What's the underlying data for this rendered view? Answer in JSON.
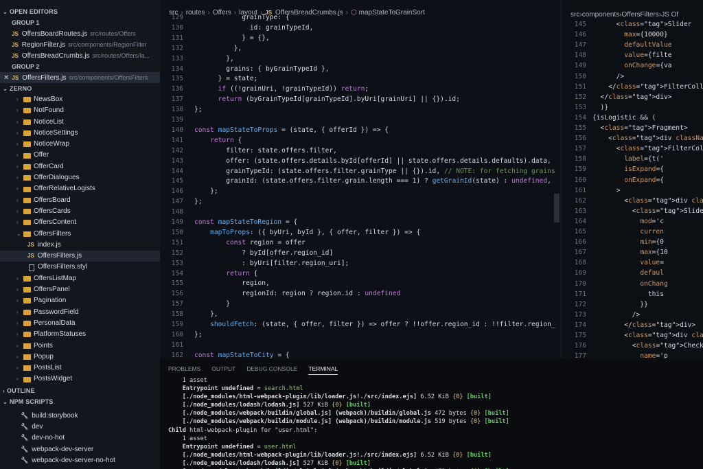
{
  "sidebar": {
    "open_editors": "OPEN EDITORS",
    "group1": "GROUP 1",
    "group2": "GROUP 2",
    "open_files_g1": [
      {
        "name": "OffersBoardRoutes.js",
        "path": "src/routes/Offers"
      },
      {
        "name": "RegionFilter.js",
        "path": "src/components/RegionFilter"
      },
      {
        "name": "OffersBreadCrumbs.js",
        "path": "src/routes/Offers/la..."
      }
    ],
    "open_files_g2": [
      {
        "name": "OffersFilters.js",
        "path": "src/components/OffersFilters"
      }
    ],
    "js_badge": "JS",
    "project": "ZERNO",
    "tree": [
      {
        "name": "NewsBox",
        "type": "folder"
      },
      {
        "name": "NotFound",
        "type": "folder"
      },
      {
        "name": "NoticeList",
        "type": "folder"
      },
      {
        "name": "NoticeSettings",
        "type": "folder"
      },
      {
        "name": "NoticeWrap",
        "type": "folder"
      },
      {
        "name": "Offer",
        "type": "folder"
      },
      {
        "name": "OfferCard",
        "type": "folder"
      },
      {
        "name": "OfferDialogues",
        "type": "folder"
      },
      {
        "name": "OfferRelativeLogists",
        "type": "folder"
      },
      {
        "name": "OffersBoard",
        "type": "folder"
      },
      {
        "name": "OffersCards",
        "type": "folder"
      },
      {
        "name": "OffersContent",
        "type": "folder"
      },
      {
        "name": "OffersFilters",
        "type": "open"
      },
      {
        "name": "index.js",
        "type": "js"
      },
      {
        "name": "OffersFilters.js",
        "type": "js",
        "selected": true
      },
      {
        "name": "OffersFilters.styl",
        "type": "file"
      },
      {
        "name": "OffersListMap",
        "type": "folder"
      },
      {
        "name": "OffersPanel",
        "type": "folder"
      },
      {
        "name": "Pagination",
        "type": "folder"
      },
      {
        "name": "PasswordField",
        "type": "folder"
      },
      {
        "name": "PersonalData",
        "type": "folder"
      },
      {
        "name": "PlatformStatuses",
        "type": "folder"
      },
      {
        "name": "Points",
        "type": "folder"
      },
      {
        "name": "Popup",
        "type": "folder"
      },
      {
        "name": "PostsList",
        "type": "folder"
      },
      {
        "name": "PostsWidget",
        "type": "folder"
      }
    ],
    "outline": "OUTLINE",
    "npm_scripts": "NPM SCRIPTS",
    "scripts": [
      "build:storybook",
      "dev",
      "dev-no-hot",
      "webpack-dev-server",
      "webpack-dev-server-no-hot"
    ]
  },
  "editor": {
    "breadcrumb": [
      "src",
      "routes",
      "Offers",
      "layout",
      "OffersBreadCrumbs.js",
      "mapStateToGrainSort"
    ],
    "lines": [
      {
        "n": "129",
        "t": "            grainType: {"
      },
      {
        "n": "130",
        "t": "              id: grainTypeId,"
      },
      {
        "n": "131",
        "t": "            } = {},"
      },
      {
        "n": "132",
        "t": "          },"
      },
      {
        "n": "133",
        "t": "        },"
      },
      {
        "n": "134",
        "t": "        grains: { byGrainTypeId },"
      },
      {
        "n": "135",
        "t": "      } = state;"
      },
      {
        "n": "136",
        "t": "      if ((!grainUri, !grainTypeId)) return;"
      },
      {
        "n": "137",
        "t": "      return (byGrainTypeId[grainTypeId].byUri[grainUri] || {}).id;"
      },
      {
        "n": "138",
        "t": "};"
      },
      {
        "n": "139",
        "t": ""
      },
      {
        "n": "140",
        "t": "const mapStateToProps = (state, { offerId }) => {"
      },
      {
        "n": "141",
        "t": "    return {"
      },
      {
        "n": "142",
        "t": "        filter: state.offers.filter,"
      },
      {
        "n": "143",
        "t": "        offer: (state.offers.details.byId[offerId] || state.offers.details.defaults).data,"
      },
      {
        "n": "144",
        "t": "        grainTypeId: (state.offers.filter.grainType || {}).id, // NOTE: for fetching grains"
      },
      {
        "n": "145",
        "t": "        grainId: (state.offers.filter.grain.length === 1) ? getGrainId(state) : undefined,"
      },
      {
        "n": "146",
        "t": "    };"
      },
      {
        "n": "147",
        "t": "};"
      },
      {
        "n": "148",
        "t": ""
      },
      {
        "n": "149",
        "t": "const mapStateToRegion = {"
      },
      {
        "n": "150",
        "t": "    mapToProps: ({ byUri, byId }, { offer, filter }) => {"
      },
      {
        "n": "151",
        "t": "        const region = offer"
      },
      {
        "n": "152",
        "t": "            ? byId[offer.region_id]"
      },
      {
        "n": "153",
        "t": "            : byUri[filter.region_uri];"
      },
      {
        "n": "154",
        "t": "        return {"
      },
      {
        "n": "155",
        "t": "            region,"
      },
      {
        "n": "156",
        "t": "            regionId: region ? region.id : undefined"
      },
      {
        "n": "157",
        "t": "        }"
      },
      {
        "n": "158",
        "t": "    },"
      },
      {
        "n": "159",
        "t": "    shouldFetch: (state, { offer, filter }) => offer ? !!offer.region_id : !!filter.region_"
      },
      {
        "n": "160",
        "t": "};"
      },
      {
        "n": "161",
        "t": ""
      },
      {
        "n": "162",
        "t": "const mapStateToCity = {"
      }
    ]
  },
  "right": {
    "breadcrumb": [
      "src",
      "components",
      "OffersFilters",
      "JS Of"
    ],
    "lines": [
      {
        "n": "145",
        "t": "      <Slider"
      },
      {
        "n": "146",
        "t": "        max={10000}"
      },
      {
        "n": "147",
        "t": "        defaultValue"
      },
      {
        "n": "148",
        "t": "        value={filte"
      },
      {
        "n": "149",
        "t": "        onChange={va"
      },
      {
        "n": "150",
        "t": "      />"
      },
      {
        "n": "151",
        "t": "    </FilterCollapse"
      },
      {
        "n": "152",
        "t": "  </div>"
      },
      {
        "n": "153",
        "t": "  )}"
      },
      {
        "n": "154",
        "t": "{isLogistic && ("
      },
      {
        "n": "155",
        "t": "  <Fragment>"
      },
      {
        "n": "156",
        "t": "    <div classNam"
      },
      {
        "n": "157",
        "t": "      <FilterColla"
      },
      {
        "n": "158",
        "t": "        label={t('"
      },
      {
        "n": "159",
        "t": "        isExpand={"
      },
      {
        "n": "160",
        "t": "        onExpand={"
      },
      {
        "n": "161",
        "t": "      >"
      },
      {
        "n": "162",
        "t": "        <div class"
      },
      {
        "n": "163",
        "t": "          <Slider"
      },
      {
        "n": "164",
        "t": "            mod='c"
      },
      {
        "n": "165",
        "t": "            curren"
      },
      {
        "n": "166",
        "t": "            min={0"
      },
      {
        "n": "167",
        "t": "            max={10"
      },
      {
        "n": "168",
        "t": "            value="
      },
      {
        "n": "169",
        "t": "            defaul"
      },
      {
        "n": "170",
        "t": "            onChang"
      },
      {
        "n": "171",
        "t": "              this"
      },
      {
        "n": "172",
        "t": "            }}"
      },
      {
        "n": "173",
        "t": "          />"
      },
      {
        "n": "174",
        "t": "        </div>"
      },
      {
        "n": "175",
        "t": "        <div classN"
      },
      {
        "n": "176",
        "t": "          <Checkbox"
      },
      {
        "n": "177",
        "t": "            name='p"
      },
      {
        "n": "178",
        "t": "            label={"
      }
    ]
  },
  "panel": {
    "tabs": [
      "PROBLEMS",
      "OUTPUT",
      "DEBUG CONSOLE",
      "TERMINAL"
    ],
    "active_tab": "TERMINAL",
    "terminal": [
      "    1 asset",
      "    Entrypoint undefined = search.html",
      "    [./node_modules/html-webpack-plugin/lib/loader.js!./src/index.ejs] 6.52 KiB {0} [built]",
      "    [./node_modules/lodash/lodash.js] 527 KiB {0} [built]",
      "    [./node_modules/webpack/buildin/global.js] (webpack)/buildin/global.js 472 bytes {0} [built]",
      "    [./node_modules/webpack/buildin/module.js] (webpack)/buildin/module.js 519 bytes {0} [built]",
      "Child html-webpack-plugin for \"user.html\":",
      "    1 asset",
      "    Entrypoint undefined = user.html",
      "    [./node_modules/html-webpack-plugin/lib/loader.js!./src/index.ejs] 6.52 KiB {0} [built]",
      "    [./node_modules/lodash/lodash.js] 527 KiB {0} [built]",
      "    [./node_modules/webpack/buildin/global.js] (webpack)/buildin/global.js 472 bytes {0} [built]",
      "    [./node_modules/webpack/buildin/module.js] (webpack)/buildin/module.js 519 bytes {0} [built]"
    ]
  }
}
